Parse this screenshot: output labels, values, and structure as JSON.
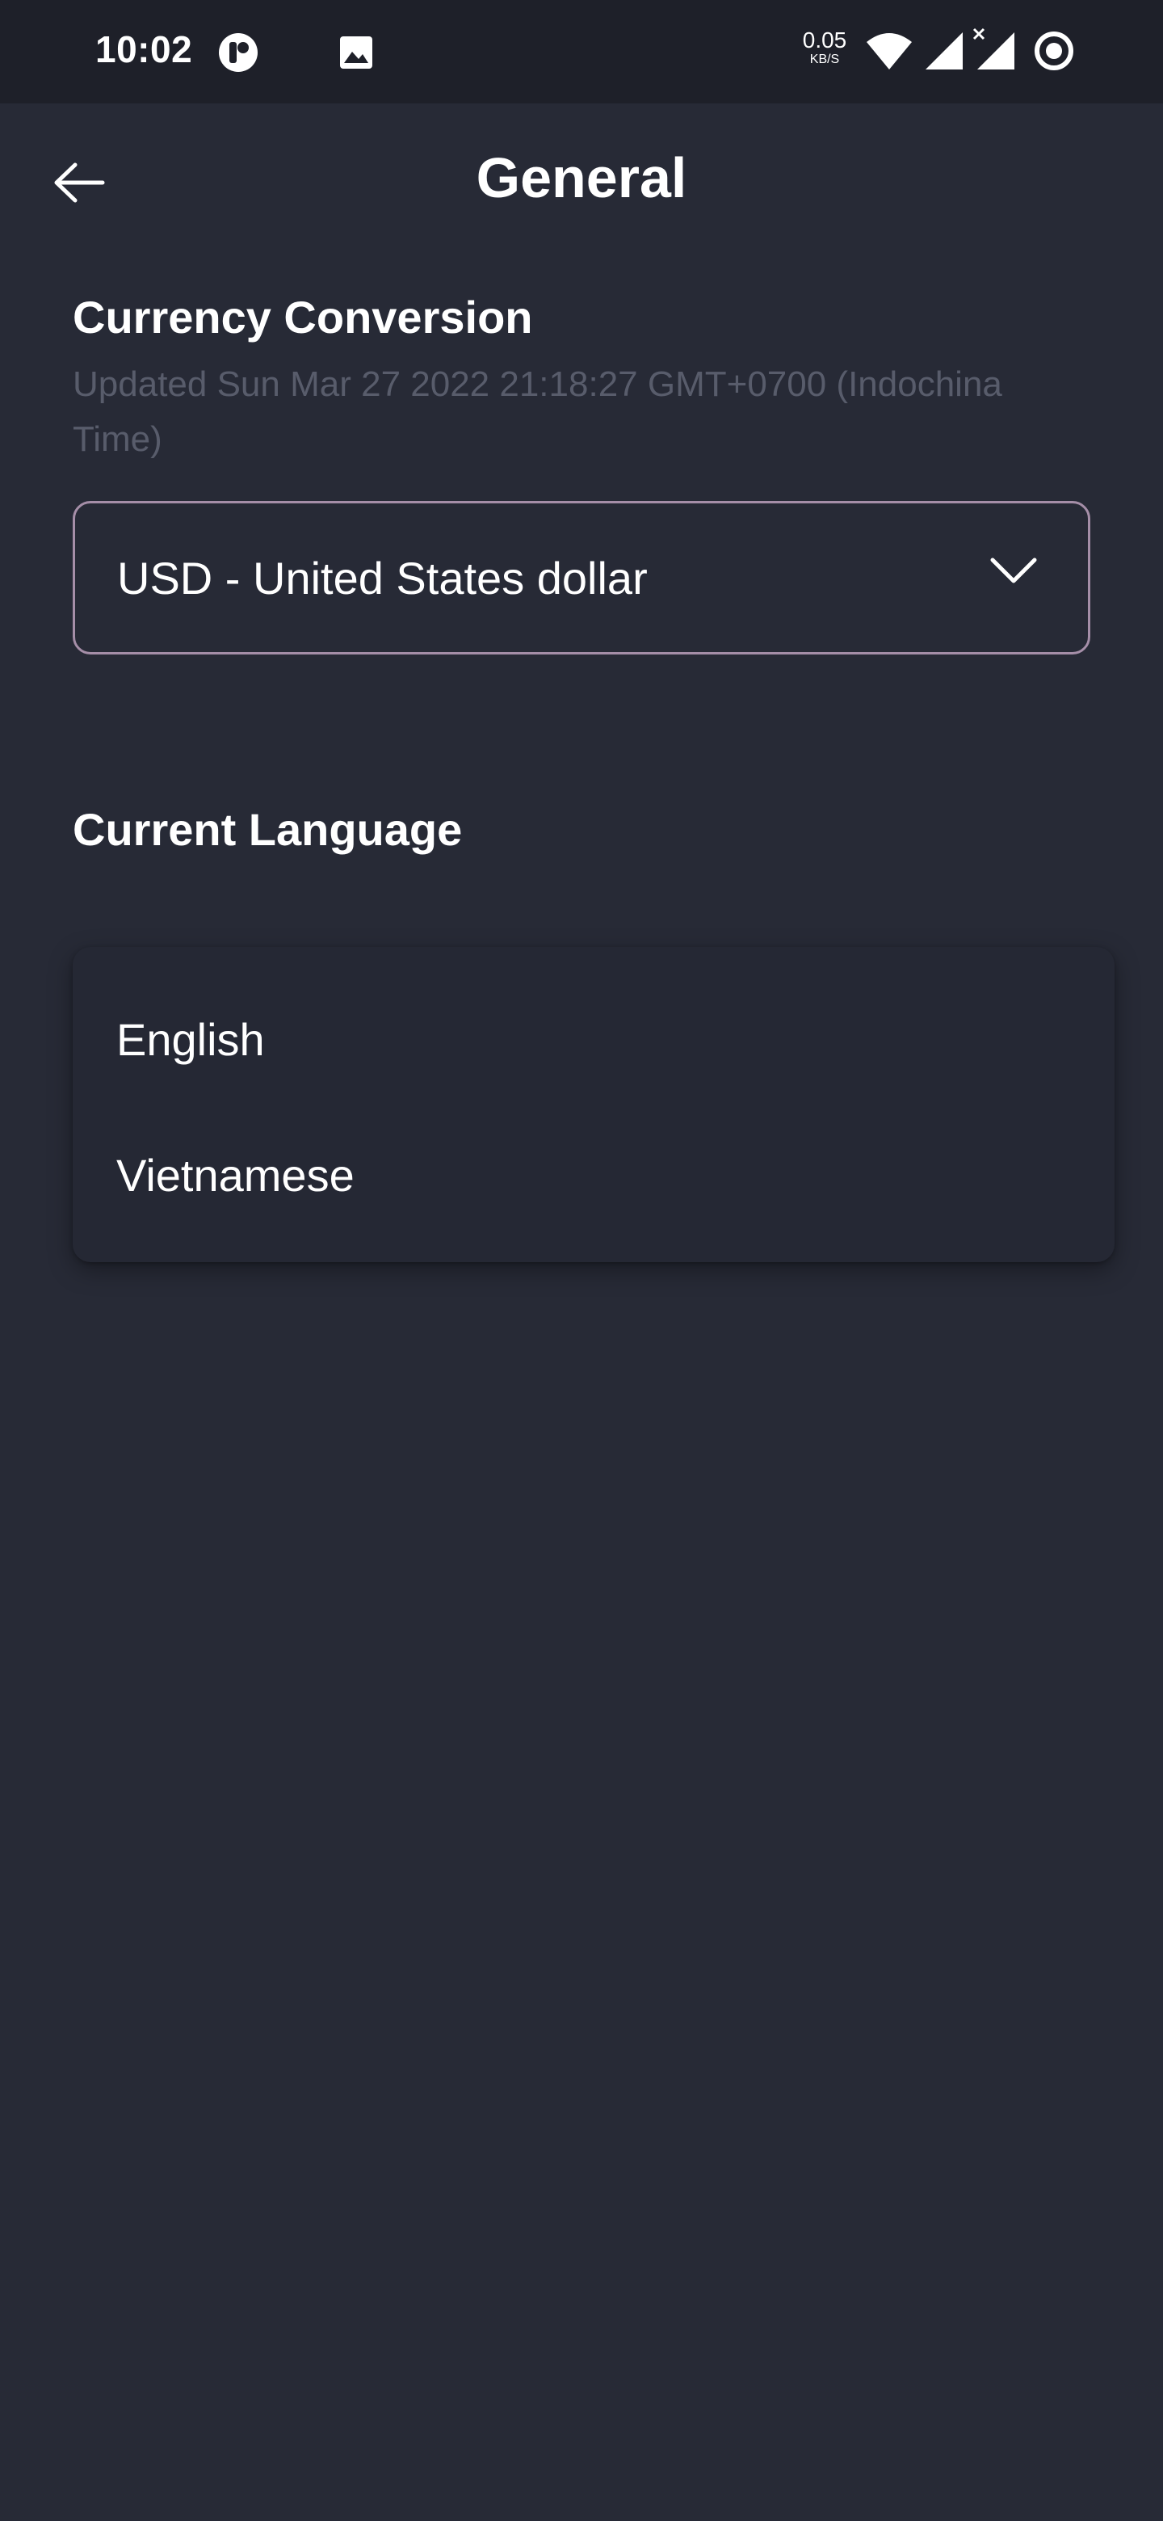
{
  "status_bar": {
    "time": "10:02",
    "net_speed_value": "0.05",
    "net_speed_unit": "KB/S",
    "icons": [
      "app-notification-icon",
      "image-notification-icon",
      "wifi-icon",
      "signal-icon",
      "signal-no-data-icon",
      "record-icon"
    ]
  },
  "header": {
    "title": "General",
    "back_icon": "arrow-left-icon"
  },
  "currency": {
    "section_title": "Currency Conversion",
    "updated_text": "Updated Sun Mar 27 2022 21:18:27 GMT+0700 (Indochina Time)",
    "selected_value": "USD - United States dollar",
    "dropdown_icon": "chevron-down-icon"
  },
  "language": {
    "section_title": "Current Language",
    "options": [
      {
        "label": "English"
      },
      {
        "label": "Vietnamese"
      }
    ]
  },
  "colors": {
    "background": "#272a36",
    "status_bar": "#1e2029",
    "muted_text": "#585c6b",
    "select_border": "#a58ea8",
    "menu_background": "#252834"
  }
}
